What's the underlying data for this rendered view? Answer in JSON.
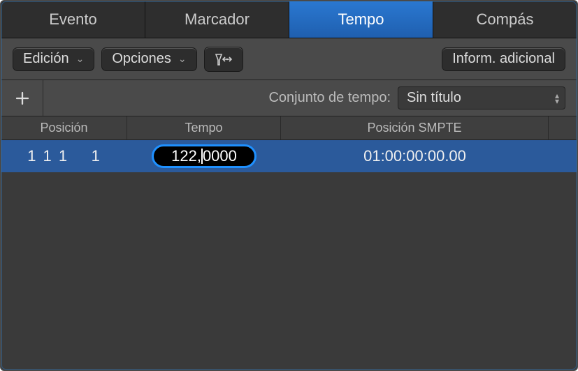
{
  "tabs": [
    {
      "label": "Evento",
      "active": false
    },
    {
      "label": "Marcador",
      "active": false
    },
    {
      "label": "Tempo",
      "active": true
    },
    {
      "label": "Compás",
      "active": false
    }
  ],
  "toolbar": {
    "edit_label": "Edición",
    "options_label": "Opciones",
    "additional_info_label": "Inform. adicional"
  },
  "subbar": {
    "tempo_set_label": "Conjunto de tempo:",
    "tempo_set_value": "Sin título"
  },
  "columns": {
    "position": "Posición",
    "tempo": "Tempo",
    "smpte": "Posición SMPTE"
  },
  "rows": [
    {
      "position": "1 1 1    1",
      "tempo_before": "122",
      "tempo_after": "0000",
      "smpte": "01:00:00:00.00",
      "selected": true,
      "editing": true
    }
  ],
  "colors": {
    "accent": "#1e63b8",
    "edit_border": "#1e90ff"
  }
}
